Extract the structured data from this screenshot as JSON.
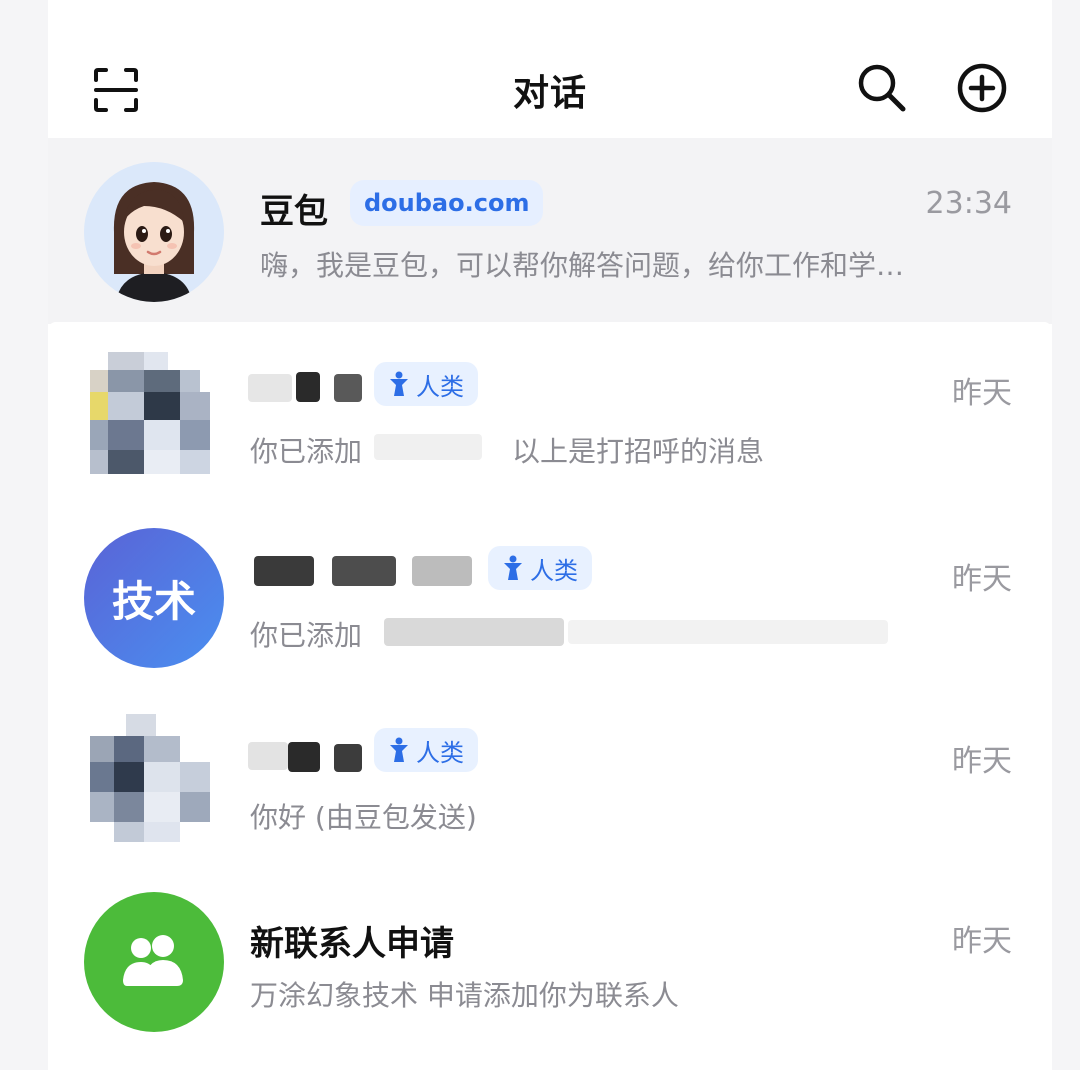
{
  "header": {
    "title": "对话",
    "icons": [
      "scan-icon",
      "search-icon",
      "add-circle-icon"
    ]
  },
  "pinned": {
    "name": "豆包",
    "badge": "doubao.com",
    "time": "23:34",
    "preview": "嗨，我是豆包，可以帮你解答问题，给你工作和学…"
  },
  "conversations": [
    {
      "avatar_text": "",
      "tag": "人类",
      "time": "昨天",
      "preview_prefix": "你已添加",
      "preview_suffix": "以上是打招呼的消息"
    },
    {
      "avatar_text": "技术",
      "tag": "人类",
      "time": "昨天",
      "preview_prefix": "你已添加"
    },
    {
      "avatar_text": "",
      "tag": "人类",
      "time": "昨天",
      "preview": "你好 (由豆包发送)"
    },
    {
      "name": "新联系人申请",
      "time": "昨天",
      "preview": "万涂幻象技术 申请添加你为联系人"
    }
  ],
  "colors": {
    "tag_bg": "#e8f1ff",
    "tag_text": "#2d6ee6",
    "tech_avatar": "#4a6fe0",
    "contacts_avatar": "#4cbb3a"
  }
}
